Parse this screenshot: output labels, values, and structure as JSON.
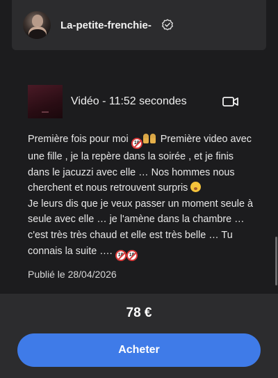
{
  "header": {
    "username": "La-petite-frenchie-",
    "verified_icon": "check-badge-icon",
    "avatar": "profile-photo"
  },
  "media": {
    "label": "Vidéo - 11:52 secondes",
    "icon": "video-camera-icon"
  },
  "description": {
    "segments": [
      "Première fois pour moi",
      "Première video avec une fille , je la repère dans la soirée , et je finis dans le jacuzzi avec elle … Nos hommes nous cherchent et nous retrouvent surpris",
      "Je leurs dis que je veux passer un moment seule à seule avec elle … je l'amène dans la chambre … c'est très très chaud et elle est très belle … Tu connais la suite …."
    ],
    "emojis": [
      "no-under-18-emoji",
      "two-women-emoji",
      "hushed-face-emoji"
    ]
  },
  "published": "Publié le 28/04/2026",
  "purchase": {
    "price": "78 €",
    "button_label": "Acheter",
    "button_color": "#3f7be8"
  },
  "colors": {
    "background": "#1c1c1e",
    "card": "#2c2c2e",
    "accent": "#3f7be8"
  }
}
